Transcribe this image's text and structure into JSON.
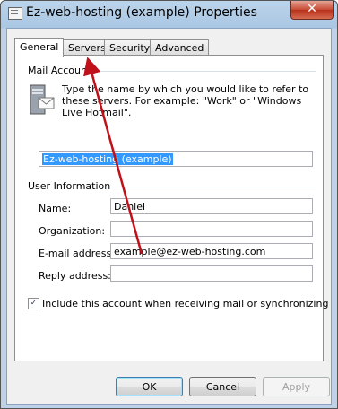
{
  "window": {
    "title": "Ez-web-hosting (example) Properties",
    "close_glyph": "✕"
  },
  "tabs": [
    {
      "label": "General"
    },
    {
      "label": "Servers"
    },
    {
      "label": "Security"
    },
    {
      "label": "Advanced"
    }
  ],
  "mail_account": {
    "heading": "Mail Account",
    "description": "Type the name by which you would like to refer to these servers. For example: \"Work\" or \"Windows Live Hotmail\".",
    "account_name": "Ez-web-hosting (example)"
  },
  "user_info": {
    "heading": "User Information",
    "name_label": "Name:",
    "name_value": "Daniel",
    "organization_label": "Organization:",
    "organization_value": "",
    "email_label": "E-mail address:",
    "email_value": "example@ez-web-hosting.com",
    "reply_label": "Reply address:",
    "reply_value": ""
  },
  "include_account": {
    "label": "Include this account when receiving mail or synchronizing",
    "checked": true,
    "check_glyph": "✓"
  },
  "buttons": {
    "ok": "OK",
    "cancel": "Cancel",
    "apply": "Apply"
  },
  "annotation_color": "#c0111b"
}
